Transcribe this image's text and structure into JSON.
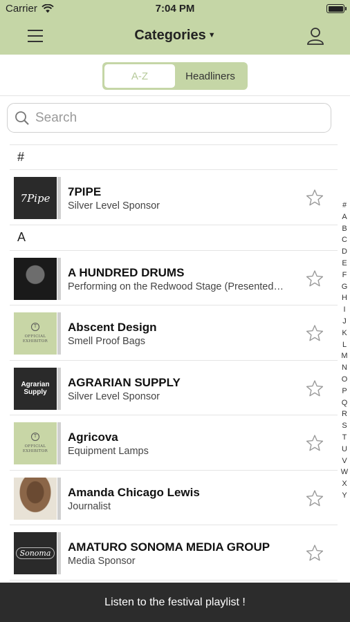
{
  "status_bar": {
    "carrier": "Carrier",
    "time": "7:04 PM"
  },
  "nav": {
    "title": "Categories"
  },
  "segments": [
    {
      "label": "A-Z",
      "active": true
    },
    {
      "label": "Headliners",
      "active": false
    }
  ],
  "search": {
    "placeholder": "Search"
  },
  "sections": [
    {
      "header": "#"
    },
    {
      "header": "A"
    }
  ],
  "rows": [
    {
      "name": "7PIPE",
      "subtitle": "Silver Level Sponsor",
      "thumb_text": "7Pipe"
    },
    {
      "name": "A HUNDRED DRUMS",
      "subtitle": "Performing on the Redwood Stage (Presented by...",
      "thumb_text": ""
    },
    {
      "name": "Abscent Design",
      "subtitle": "Smell Proof Bags",
      "thumb_text": "OFFICIAL EXHIBITOR"
    },
    {
      "name": "AGRARIAN SUPPLY",
      "subtitle": "Silver Level Sponsor",
      "thumb_text": "Agrarian Supply"
    },
    {
      "name": "Agricova",
      "subtitle": "Equipment Lamps",
      "thumb_text": "OFFICIAL EXHIBITOR"
    },
    {
      "name": "Amanda Chicago Lewis",
      "subtitle": "Journalist",
      "thumb_text": ""
    },
    {
      "name": "AMATURO SONOMA MEDIA GROUP",
      "subtitle": "Media Sponsor",
      "thumb_text": "Sonoma"
    }
  ],
  "index_letters": [
    "#",
    "A",
    "B",
    "C",
    "D",
    "E",
    "F",
    "G",
    "H",
    "I",
    "J",
    "K",
    "L",
    "M",
    "N",
    "O",
    "P",
    "Q",
    "R",
    "S",
    "T",
    "U",
    "V",
    "W",
    "X",
    "Y"
  ],
  "bottom_bar": {
    "label": "Listen to the festival playlist !"
  },
  "colors": {
    "accent": "#c5d6a6",
    "bottom_bar": "#2c2c2c"
  }
}
